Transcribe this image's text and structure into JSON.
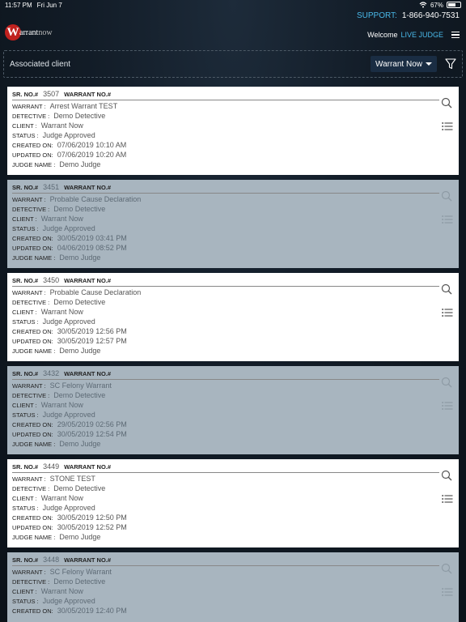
{
  "status_bar": {
    "time": "11:57 PM",
    "date": "Fri Jun 7",
    "battery": "67%",
    "battery_level": 0.67
  },
  "support": {
    "label": "SUPPORT:",
    "phone": "1-866-940-7531"
  },
  "logo": {
    "initial": "W",
    "text1": "arrant",
    "text2": "now"
  },
  "welcome": {
    "label": "Welcome",
    "user": "LIVE JUDGE"
  },
  "filter": {
    "title": "Associated client",
    "selected": "Warrant Now"
  },
  "labels": {
    "sr_no": "SR. NO.#",
    "warrant_no": "WARRANT NO.#",
    "warrant": "WARRANT :",
    "detective": "DETECTIVE :",
    "client": "CLIENT :",
    "status": "STATUS :",
    "created_on": "CREATED ON:",
    "updated_on": "UPDATED ON:",
    "judge_name": "JUDGE NAME :"
  },
  "records": [
    {
      "sr_no": "3507",
      "warrant": "Arrest Warrant TEST",
      "detective": "Demo Detective",
      "client": "Warrant Now",
      "status": "Judge Approved",
      "created_on": "07/06/2019 10:10 AM",
      "updated_on": "07/06/2019 10:20 AM",
      "judge_name": "Demo Judge"
    },
    {
      "sr_no": "3451",
      "warrant": "Probable Cause Declaration",
      "detective": "Demo Detective",
      "client": "Warrant Now",
      "status": "Judge Approved",
      "created_on": "30/05/2019 03:41 PM",
      "updated_on": "04/06/2019 08:52 PM",
      "judge_name": "Demo Judge"
    },
    {
      "sr_no": "3450",
      "warrant": "Probable Cause Declaration",
      "detective": "Demo Detective",
      "client": "Warrant Now",
      "status": "Judge Approved",
      "created_on": "30/05/2019 12:56 PM",
      "updated_on": "30/05/2019 12:57 PM",
      "judge_name": "Demo Judge"
    },
    {
      "sr_no": "3432",
      "warrant": "SC Felony Warrant",
      "detective": "Demo Detective",
      "client": "Warrant Now",
      "status": "Judge Approved",
      "created_on": "29/05/2019 02:56 PM",
      "updated_on": "30/05/2019 12:54 PM",
      "judge_name": "Demo Judge"
    },
    {
      "sr_no": "3449",
      "warrant": "STONE TEST",
      "detective": "Demo Detective",
      "client": "Warrant Now",
      "status": "Judge Approved",
      "created_on": "30/05/2019 12:50 PM",
      "updated_on": "30/05/2019 12:52 PM",
      "judge_name": "Demo Judge"
    },
    {
      "sr_no": "3448",
      "warrant": "SC Felony Warrant",
      "detective": "Demo Detective",
      "client": "Warrant Now",
      "status": "Judge Approved",
      "created_on": "30/05/2019 12:40 PM",
      "updated_on": "",
      "judge_name": ""
    }
  ]
}
